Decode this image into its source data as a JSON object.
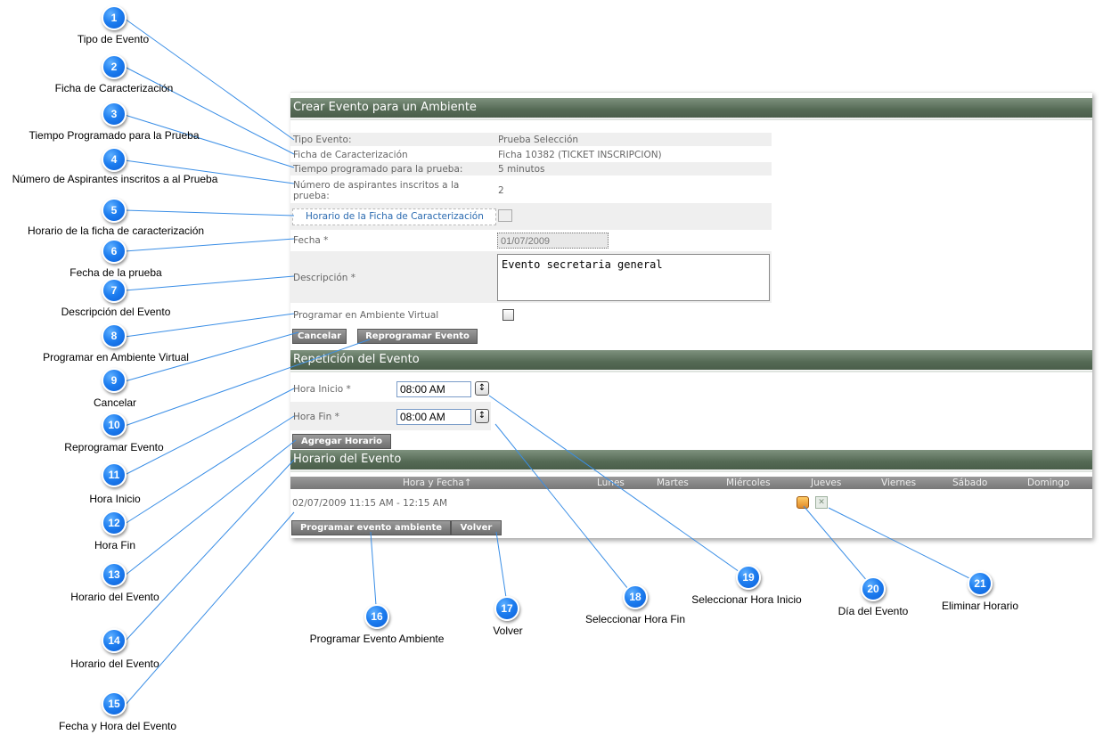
{
  "panel": {
    "title": "Crear Evento para un Ambiente",
    "fields": {
      "tipo_evento_label": "Tipo Evento:",
      "tipo_evento_value": "Prueba Selección",
      "ficha_label": "Ficha de Caracterización",
      "ficha_value": "Ficha 10382 (TICKET INSCRIPCION)",
      "tiempo_label": "Tiempo programado para la prueba:",
      "tiempo_value": "5 minutos",
      "aspirantes_label_1": "Número de aspirantes inscritos a la",
      "aspirantes_label_2": "prueba:",
      "aspirantes_value": "2",
      "horario_ficha_link": "Horario de la Ficha de Caracterización",
      "fecha_label": "Fecha *",
      "fecha_value": "01/07/2009",
      "descripcion_label": "Descripción *",
      "descripcion_value": "Evento secretaria general",
      "virtual_label": "Programar en Ambiente Virtual"
    },
    "buttons": {
      "cancelar": "Cancelar",
      "reprogramar": "Reprogramar Evento",
      "agregar_horario": "Agregar Horario",
      "programar_ambiente": "Programar evento ambiente",
      "volver": "Volver"
    },
    "repeticion": {
      "title": "Repetición del Evento",
      "hora_inicio_label": "Hora Inicio *",
      "hora_inicio_value": "08:00 AM",
      "hora_fin_label": "Hora Fin *",
      "hora_fin_value": "08:00 AM"
    },
    "horario": {
      "title": "Horario del Evento",
      "columns": [
        "Hora y Fecha↑",
        "Lunes",
        "Martes",
        "Miércoles",
        "Jueves",
        "Viernes",
        "Sábado",
        "Domingo"
      ],
      "row_datetime": "02/07/2009 11:15 AM - 12:15 AM"
    }
  },
  "callouts": [
    {
      "n": "1",
      "label": "Tipo de Evento"
    },
    {
      "n": "2",
      "label": "Ficha de Caracterización"
    },
    {
      "n": "3",
      "label": "Tiempo Programado para la Prueba"
    },
    {
      "n": "4",
      "label": "Número de Aspirantes inscritos a al Prueba"
    },
    {
      "n": "5",
      "label": "Horario de la ficha de caracterización"
    },
    {
      "n": "6",
      "label": "Fecha de la prueba"
    },
    {
      "n": "7",
      "label": "Descripción del Evento"
    },
    {
      "n": "8",
      "label": "Programar en Ambiente Virtual"
    },
    {
      "n": "9",
      "label": "Cancelar"
    },
    {
      "n": "10",
      "label": "Reprogramar Evento"
    },
    {
      "n": "11",
      "label": "Hora Inicio"
    },
    {
      "n": "12",
      "label": "Hora Fin"
    },
    {
      "n": "13",
      "label": "Horario del Evento"
    },
    {
      "n": "14",
      "label": "Horario del Evento"
    },
    {
      "n": "15",
      "label": "Fecha y Hora del Evento"
    },
    {
      "n": "16",
      "label": "Programar Evento Ambiente"
    },
    {
      "n": "17",
      "label": "Volver"
    },
    {
      "n": "18",
      "label": "Seleccionar Hora Fin"
    },
    {
      "n": "19",
      "label": "Seleccionar Hora Inicio"
    },
    {
      "n": "20",
      "label": "Día del Evento"
    },
    {
      "n": "21",
      "label": "Eliminar Horario"
    }
  ],
  "icons": {
    "day": "calendar-day-icon",
    "delete": "delete-schedule-icon",
    "clock_up_down": "time-spinner-icon"
  }
}
